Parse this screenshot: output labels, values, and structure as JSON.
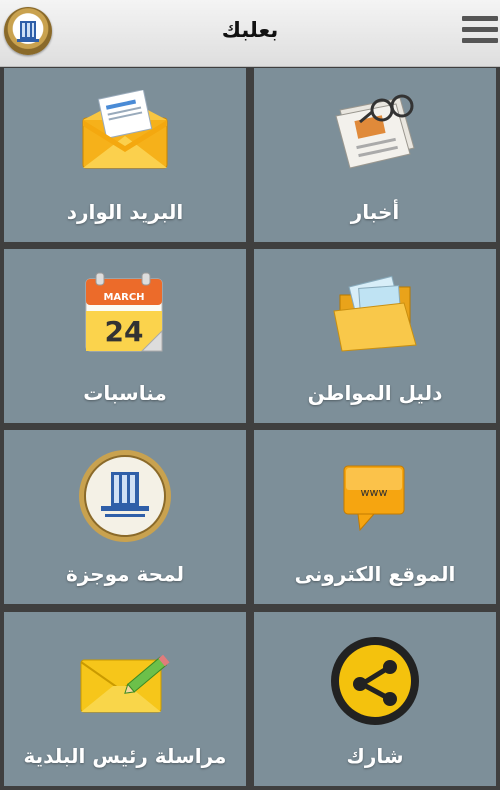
{
  "header": {
    "title": "بعلبك",
    "logo": "baalbek-municipality-logo",
    "menu_icon": "hamburger-menu-icon"
  },
  "tiles": [
    {
      "label": "البريد الوارد",
      "icon": "inbox-envelope-icon"
    },
    {
      "label": "أخبار",
      "icon": "newspaper-icon"
    },
    {
      "label": "مناسبات",
      "icon": "calendar-icon",
      "calendar_month": "MARCH",
      "calendar_day": "24"
    },
    {
      "label": "دليل المواطن",
      "icon": "folder-icon"
    },
    {
      "label": "لمحة موجزة",
      "icon": "municipality-seal-icon"
    },
    {
      "label": "الموقع الكترونى",
      "icon": "website-sign-icon",
      "icon_text": "www"
    },
    {
      "label": "مراسلة رئيس البلدية",
      "icon": "letter-pencil-icon"
    },
    {
      "label": "شارك",
      "icon": "share-icon"
    }
  ],
  "colors": {
    "tile_background": "#7d8f99",
    "grid_background": "#3f3f3f",
    "header_background": "#e8e8e8"
  }
}
